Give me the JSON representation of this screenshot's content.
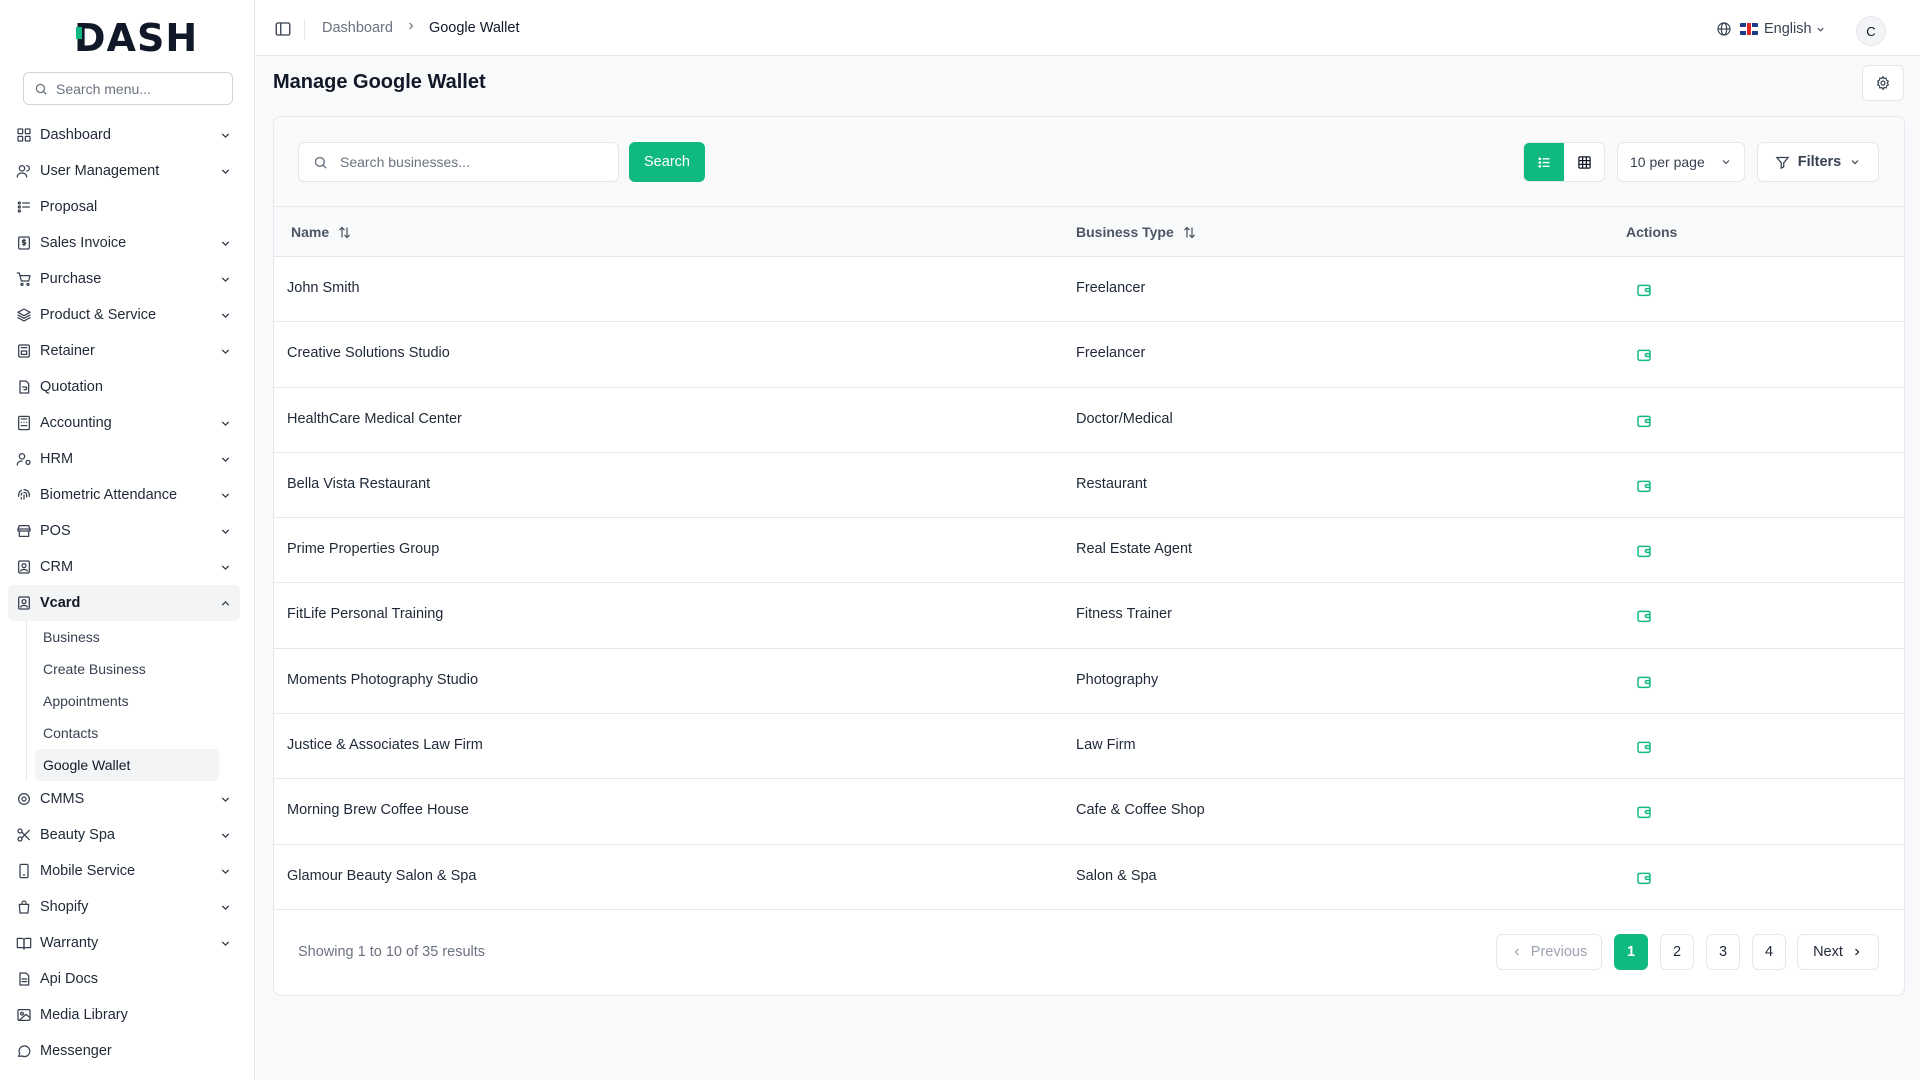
{
  "brand": {
    "logo_text": "DASH"
  },
  "sidebar": {
    "search_placeholder": "Search menu...",
    "items": [
      {
        "label": "Dashboard",
        "icon": "grid-icon",
        "chevron": "down"
      },
      {
        "label": "User Management",
        "icon": "users-icon",
        "chevron": "down"
      },
      {
        "label": "Proposal",
        "icon": "proposal-icon",
        "chevron": ""
      },
      {
        "label": "Sales Invoice",
        "icon": "invoice-icon",
        "chevron": "down"
      },
      {
        "label": "Purchase",
        "icon": "cart-icon",
        "chevron": "down"
      },
      {
        "label": "Product & Service",
        "icon": "layers-icon",
        "chevron": "down"
      },
      {
        "label": "Retainer",
        "icon": "retainer-icon",
        "chevron": "down"
      },
      {
        "label": "Quotation",
        "icon": "quotation-icon",
        "chevron": ""
      },
      {
        "label": "Accounting",
        "icon": "calculator-icon",
        "chevron": "down"
      },
      {
        "label": "HRM",
        "icon": "hrm-icon",
        "chevron": "down"
      },
      {
        "label": "Biometric Attendance",
        "icon": "fingerprint-icon",
        "chevron": "down"
      },
      {
        "label": "POS",
        "icon": "store-icon",
        "chevron": "down"
      },
      {
        "label": "CRM",
        "icon": "contact-card-icon",
        "chevron": "down"
      },
      {
        "label": "Vcard",
        "icon": "vcard-icon",
        "chevron": "up"
      }
    ],
    "vcard_sub": [
      "Business",
      "Create Business",
      "Appointments",
      "Contacts",
      "Google Wallet"
    ],
    "items_after": [
      {
        "label": "CMMS",
        "icon": "cog-icon",
        "chevron": "down"
      },
      {
        "label": "Beauty Spa",
        "icon": "scissors-icon",
        "chevron": "down"
      },
      {
        "label": "Mobile Service",
        "icon": "mobile-icon",
        "chevron": "down"
      },
      {
        "label": "Shopify",
        "icon": "shopping-bag-icon",
        "chevron": "down"
      },
      {
        "label": "Warranty",
        "icon": "book-icon",
        "chevron": "down"
      },
      {
        "label": "Api Docs",
        "icon": "doc-icon",
        "chevron": ""
      },
      {
        "label": "Media Library",
        "icon": "image-icon",
        "chevron": ""
      },
      {
        "label": "Messenger",
        "icon": "chat-icon",
        "chevron": ""
      }
    ]
  },
  "header": {
    "breadcrumb": [
      "Dashboard",
      "Google Wallet"
    ],
    "language": "English",
    "avatar_initial": "C"
  },
  "page": {
    "title": "Manage Google Wallet"
  },
  "toolbar": {
    "search_placeholder": "Search businesses...",
    "search_label": "Search",
    "per_page": "10 per page",
    "filters_label": "Filters"
  },
  "table": {
    "columns": [
      "Name",
      "Business Type",
      "Actions"
    ],
    "rows": [
      {
        "name": "John Smith",
        "type": "Freelancer"
      },
      {
        "name": "Creative Solutions Studio",
        "type": "Freelancer"
      },
      {
        "name": "HealthCare Medical Center",
        "type": "Doctor/Medical"
      },
      {
        "name": "Bella Vista Restaurant",
        "type": "Restaurant"
      },
      {
        "name": "Prime Properties Group",
        "type": "Real Estate Agent"
      },
      {
        "name": "FitLife Personal Training",
        "type": "Fitness Trainer"
      },
      {
        "name": "Moments Photography Studio",
        "type": "Photography"
      },
      {
        "name": "Justice & Associates Law Firm",
        "type": "Law Firm"
      },
      {
        "name": "Morning Brew Coffee House",
        "type": "Cafe & Coffee Shop"
      },
      {
        "name": "Glamour Beauty Salon & Spa",
        "type": "Salon & Spa"
      }
    ]
  },
  "pagination": {
    "summary": "Showing 1 to 10 of 35 results",
    "previous": "Previous",
    "next": "Next",
    "pages": [
      "1",
      "2",
      "3",
      "4"
    ],
    "current": "1"
  },
  "colors": {
    "accent": "#10b981"
  }
}
